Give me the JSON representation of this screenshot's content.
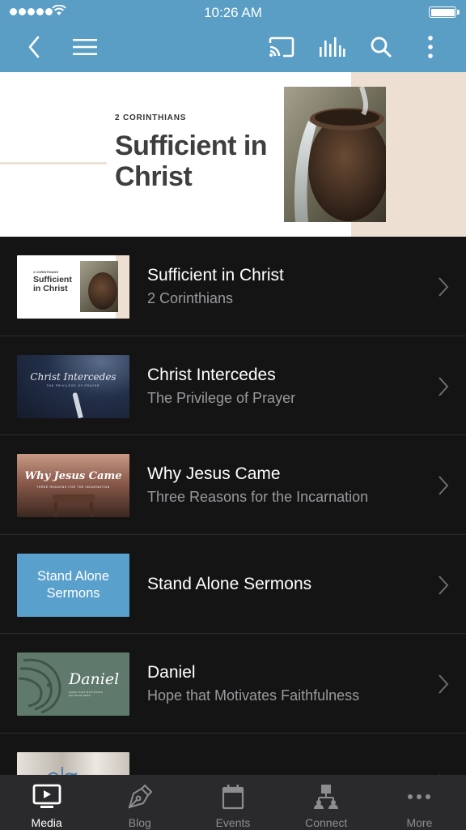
{
  "status_bar": {
    "time": "10:26 AM"
  },
  "nav": {
    "back_icon": "chevron-left-icon",
    "menu_icon": "hamburger-icon",
    "cast_icon": "cast-icon",
    "audio_icon": "audio-bars-icon",
    "search_icon": "search-icon",
    "more_icon": "vertical-dots-icon"
  },
  "hero": {
    "kicker": "2 CORINTHIANS",
    "title": "Sufficient in Christ",
    "colors": {
      "background": "#ffffff",
      "accent_beige": "#ede0d3"
    }
  },
  "series": [
    {
      "title": "Sufficient in Christ",
      "subtitle": "2 Corinthians",
      "thumb_text": "Sufficient in Christ",
      "thumb_kicker": "2 CORINTHIANS"
    },
    {
      "title": "Christ Intercedes",
      "subtitle": "The Privilege of Prayer",
      "thumb_text": "Christ Intercedes",
      "thumb_kicker": "THE PRIVILEGE OF PRAYER"
    },
    {
      "title": "Why Jesus Came",
      "subtitle": "Three Reasons for the Incarnation",
      "thumb_text": "Why Jesus Came",
      "thumb_kicker": "THREE REASONS FOR THE INCARNATION"
    },
    {
      "title": "Stand Alone Sermons",
      "subtitle": "",
      "thumb_text": "Stand Alone Sermons",
      "thumb_kicker": ""
    },
    {
      "title": "Daniel",
      "subtitle": "Hope that Motivates Faithfulness",
      "thumb_text": "Daniel",
      "thumb_kicker": "HOPE THAT MOTIVATES FAITHFULNESS"
    },
    {
      "title": "",
      "subtitle": "",
      "thumb_text": "",
      "thumb_kicker": ""
    }
  ],
  "tabs": [
    {
      "label": "Media",
      "icon": "tv-play-icon",
      "active": true
    },
    {
      "label": "Blog",
      "icon": "pen-nib-icon",
      "active": false
    },
    {
      "label": "Events",
      "icon": "calendar-icon",
      "active": false
    },
    {
      "label": "Connect",
      "icon": "people-network-icon",
      "active": false
    },
    {
      "label": "More",
      "icon": "horizontal-dots-icon",
      "active": false
    }
  ],
  "colors": {
    "header": "#5a9dc5",
    "list_background": "#141415",
    "tab_bar": "#2a2a2c",
    "stand_alone_tile": "#5aa0cc"
  }
}
